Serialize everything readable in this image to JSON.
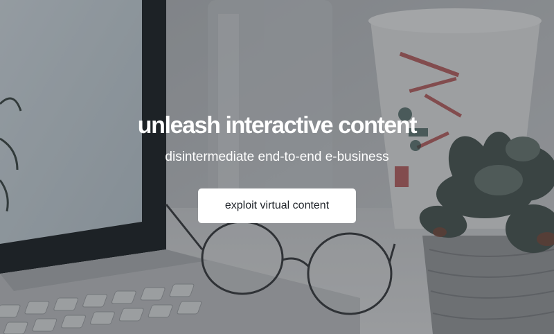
{
  "hero": {
    "headline": "unleash interactive content",
    "subheadline": "disintermediate end-to-end e-business",
    "cta_label": "exploit virtual content"
  },
  "background": {
    "description_icons": [
      "laptop-icon",
      "eyeglasses-icon",
      "succulent-plant-icon",
      "coffee-cup-icon"
    ],
    "overlay_color": "#1e2228"
  }
}
